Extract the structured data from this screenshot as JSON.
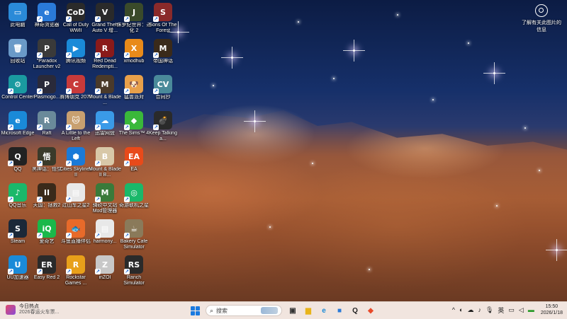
{
  "desktop_icons": [
    {
      "label": "此电脑",
      "icon": "computer-icon",
      "color": "#2a8ad8",
      "glyph": "▭"
    },
    {
      "label": "回收站",
      "icon": "recycle-bin-icon",
      "color": "#6a9ac8",
      "glyph": "🗑"
    },
    {
      "label": "Control Center",
      "icon": "control-center-icon",
      "color": "#1a9aa0",
      "glyph": "⚙"
    },
    {
      "label": "Microsoft Edge",
      "icon": "edge-icon",
      "color": "#1a8ad8",
      "glyph": "e"
    },
    {
      "label": "QQ",
      "icon": "qq-icon",
      "color": "#222222",
      "glyph": "Q"
    },
    {
      "label": "QQ音乐",
      "icon": "qq-music-icon",
      "color": "#1ab86a",
      "glyph": "♪"
    },
    {
      "label": "Steam",
      "icon": "steam-icon",
      "color": "#1b2838",
      "glyph": "S"
    },
    {
      "label": "UU加速器",
      "icon": "uu-accelerator-icon",
      "color": "#1a8ad8",
      "glyph": "U"
    },
    {
      "label": "神奇浏览器",
      "icon": "browser-icon",
      "color": "#2a7ad8",
      "glyph": "e"
    },
    {
      "label": "\"Paradox Launcher v2",
      "icon": "paradox-launcher-icon",
      "color": "#3a3a3a",
      "glyph": "P"
    },
    {
      "label": "Plasmogo...",
      "icon": "plasmogo-icon",
      "color": "#2a2a3a",
      "glyph": "P"
    },
    {
      "label": "Raft",
      "icon": "raft-icon",
      "color": "#6a8a9a",
      "glyph": "R"
    },
    {
      "label": "黑神话：悟空",
      "icon": "black-myth-icon",
      "color": "#3a3a2a",
      "glyph": "悟"
    },
    {
      "label": "天国：拯救2",
      "icon": "kingdom-come-icon",
      "color": "#3a2a1a",
      "glyph": "II"
    },
    {
      "label": "爱奇艺",
      "icon": "iqiyi-icon",
      "color": "#1ab84a",
      "glyph": "iQ"
    },
    {
      "label": "Easy Red 2",
      "icon": "easy-red-icon",
      "color": "#2a2a2a",
      "glyph": "ER"
    },
    {
      "label": "Call of Duty WWII",
      "icon": "call-of-duty-icon",
      "color": "#2a2a2a",
      "glyph": "CoD"
    },
    {
      "label": "腾讯视频",
      "icon": "tencent-video-icon",
      "color": "#1a8ad8",
      "glyph": "▶"
    },
    {
      "label": "赛博朋克 2077",
      "icon": "cyberpunk-icon",
      "color": "#c83a3a",
      "glyph": "C"
    },
    {
      "label": "A Little to the Left",
      "icon": "little-to-the-left-icon",
      "color": "#c8a070",
      "glyph": "🐱"
    },
    {
      "label": "Cities Skylines II",
      "icon": "cities-skylines-icon",
      "color": "#1a7ad8",
      "glyph": "⬢"
    },
    {
      "label": "过山车之星2",
      "icon": "document-icon",
      "color": "#e8e8e8",
      "glyph": "▤"
    },
    {
      "label": "斗鱼直播伴侣",
      "icon": "douyu-icon",
      "color": "#e86a2a",
      "glyph": "🐟"
    },
    {
      "label": "Rockstar Games ...",
      "icon": "rockstar-icon",
      "color": "#e8a01a",
      "glyph": "R"
    },
    {
      "label": "Grand Theft Auto V 增...",
      "icon": "gta-icon",
      "color": "#2a2a2a",
      "glyph": "V"
    },
    {
      "label": "Red Dead Redempti...",
      "icon": "red-dead-icon",
      "color": "#8a1a1a",
      "glyph": "R"
    },
    {
      "label": "Mount & Blade ...",
      "icon": "mount-blade-icon",
      "color": "#4a3a2a",
      "glyph": "M"
    },
    {
      "label": "迅雷网盘",
      "icon": "thunder-drive-icon",
      "color": "#3a9ae8",
      "glyph": "☁"
    },
    {
      "label": "Mount & Blade II B...",
      "icon": "bannerlord-icon",
      "color": "#d8c8a8",
      "glyph": "B"
    },
    {
      "label": "骑砍中文站 Mod管理器",
      "icon": "mod-manager-icon",
      "color": "#3a7a3a",
      "glyph": "M"
    },
    {
      "label": "harmony...",
      "icon": "document-icon",
      "color": "#e8e8e8",
      "glyph": "▤"
    },
    {
      "label": "inZOI",
      "icon": "inzoi-icon",
      "color": "#c8c8c8",
      "glyph": "Z"
    },
    {
      "label": "侏罗纪世界：进化 2",
      "icon": "jurassic-world-icon",
      "color": "#3a4a2a",
      "glyph": "J"
    },
    {
      "label": "xmodhub",
      "icon": "xmodhub-icon",
      "color": "#e88a1a",
      "glyph": "X"
    },
    {
      "label": "猛兽派对",
      "icon": "party-animals-icon",
      "color": "#e8a04a",
      "glyph": "🐶"
    },
    {
      "label": "The Sims™ 4",
      "icon": "sims-icon",
      "color": "#3ab83a",
      "glyph": "◆"
    },
    {
      "label": "EA",
      "icon": "ea-icon",
      "color": "#e84a1a",
      "glyph": "EA"
    },
    {
      "label": "奇游联机之星",
      "icon": "qiyou-icon",
      "color": "#1ab86a",
      "glyph": "◎"
    },
    {
      "label": "Bakery Cafe Simulator",
      "icon": "bakery-cafe-icon",
      "color": "#8a7a5a",
      "glyph": "☕"
    },
    {
      "label": "Ranch Simulator",
      "icon": "ranch-simulator-icon",
      "color": "#2a2a2a",
      "glyph": "RS"
    },
    {
      "label": "Sons Of The Forest",
      "icon": "sons-of-forest-icon",
      "color": "#8a2a2a",
      "glyph": "S"
    },
    {
      "label": "帝国神话",
      "icon": "empire-myth-icon",
      "color": "#3a2a1a",
      "glyph": "M"
    },
    {
      "label": "合同抄",
      "icon": "cv-icon",
      "color": "#4a8a9a",
      "glyph": "CV"
    },
    {
      "label": "Keep Talking a...",
      "icon": "keep-talking-icon",
      "color": "#2a2a2a",
      "glyph": "💣"
    }
  ],
  "widget": {
    "label": "了解有关此图片的信息",
    "icon": "camera-icon"
  },
  "taskbar": {
    "news_title": "今日热点",
    "news_sub": "2026春运火车票...",
    "search_placeholder": "搜索",
    "apps": [
      {
        "icon": "task-view-icon",
        "glyph": "▣",
        "color": "#333333"
      },
      {
        "icon": "file-explorer-icon",
        "glyph": "▆",
        "color": "#e8b41a"
      },
      {
        "icon": "edge-icon",
        "glyph": "e",
        "color": "#1a8ad8"
      },
      {
        "icon": "store-icon",
        "glyph": "■",
        "color": "#2a7ad8"
      },
      {
        "icon": "qq-icon",
        "glyph": "Q",
        "color": "#222222"
      },
      {
        "icon": "app-icon",
        "glyph": "◆",
        "color": "#e84a2a"
      }
    ],
    "tray": {
      "chevron": "^",
      "ime": "英",
      "time": "15:50",
      "date": "2026/1/18"
    }
  }
}
